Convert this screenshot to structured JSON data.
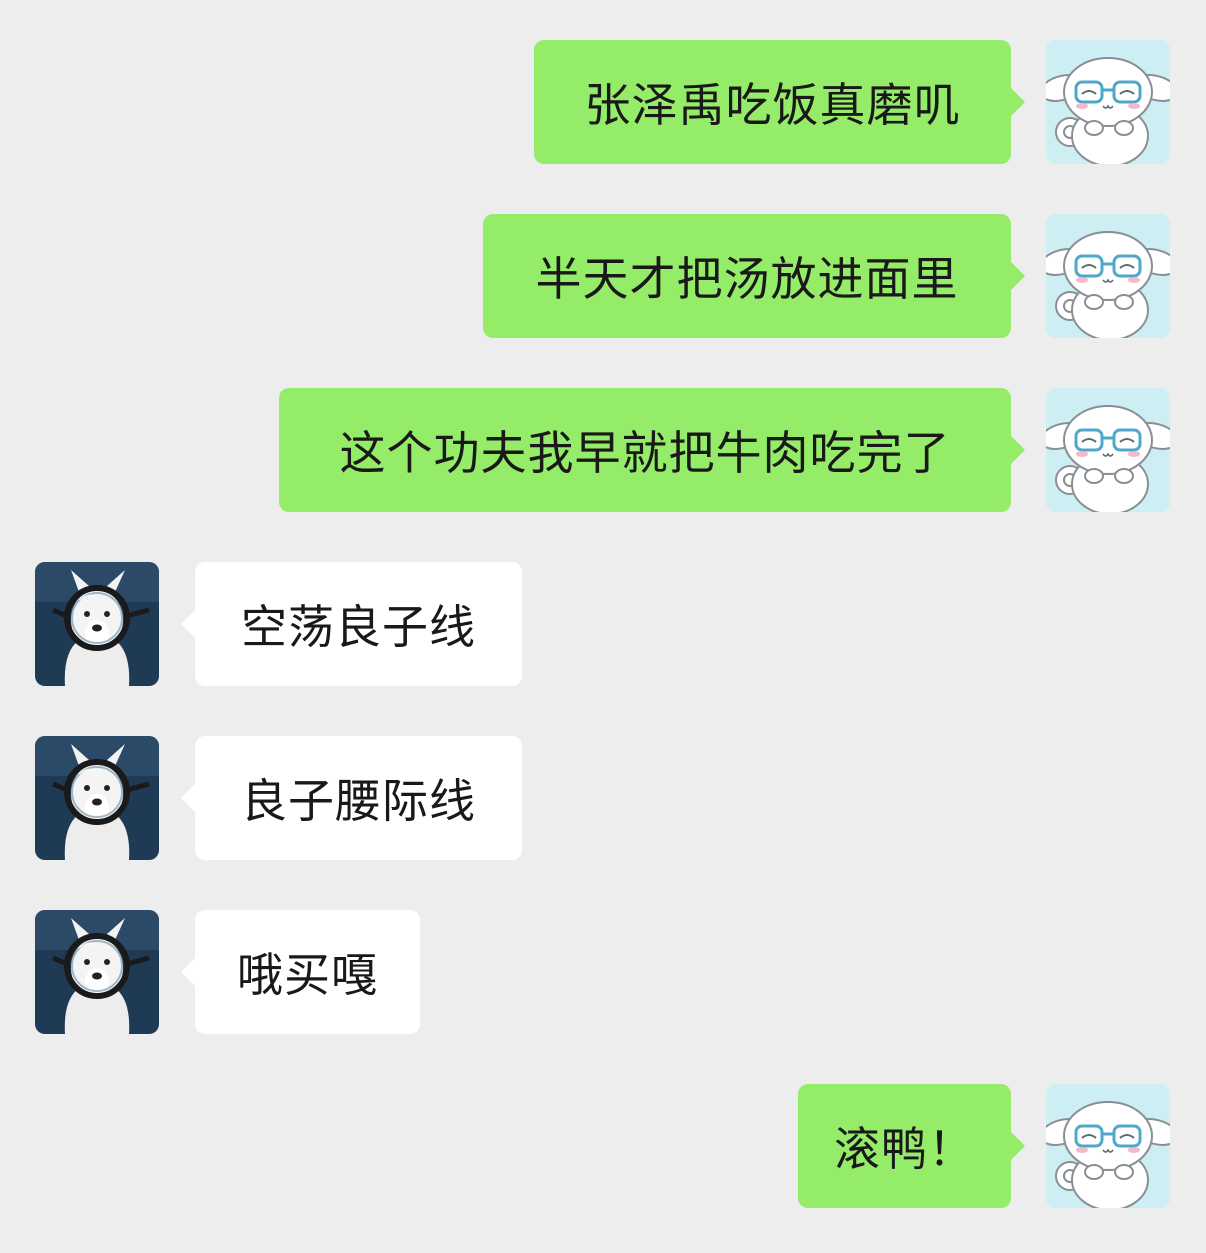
{
  "chat": {
    "messages": [
      {
        "side": "right",
        "text": "张泽禹吃饭真磨叽",
        "avatar": "cinnamoroll-avatar"
      },
      {
        "side": "right",
        "text": "半天才把汤放进面里",
        "avatar": "cinnamoroll-avatar"
      },
      {
        "side": "right",
        "text": "这个功夫我早就把牛肉吃完了",
        "avatar": "cinnamoroll-avatar"
      },
      {
        "side": "left",
        "text": "空荡良子线",
        "avatar": "dog-with-glasses-avatar"
      },
      {
        "side": "left",
        "text": "良子腰际线",
        "avatar": "dog-with-glasses-avatar"
      },
      {
        "side": "left",
        "text": "哦买嘎",
        "avatar": "dog-with-glasses-avatar"
      },
      {
        "side": "right",
        "text": "滚鸭！",
        "avatar": "cinnamoroll-avatar"
      }
    ]
  },
  "colors": {
    "background": "#ededed",
    "sent_bubble": "#95ec69",
    "received_bubble": "#ffffff",
    "text": "#191919"
  }
}
